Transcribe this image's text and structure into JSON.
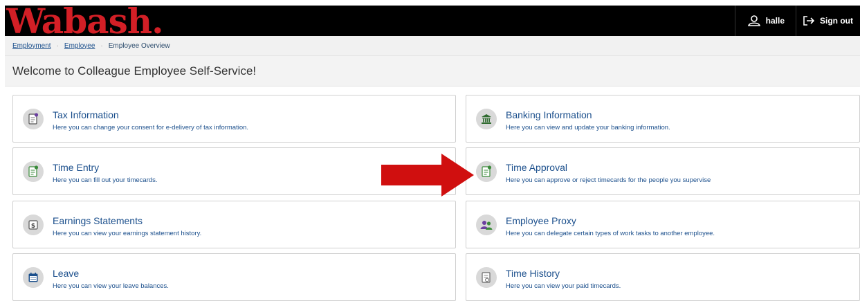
{
  "header": {
    "logo_text": "Wabash.",
    "user_label": "halle",
    "signout_label": "Sign out"
  },
  "breadcrumb": {
    "items": [
      "Employment",
      "Employee",
      "Employee Overview"
    ]
  },
  "welcome": "Welcome to Colleague Employee Self-Service!",
  "cards": [
    {
      "title": "Tax Information",
      "desc": "Here you can change your consent for e-delivery of tax information.",
      "icon": "tax-document-icon"
    },
    {
      "title": "Banking Information",
      "desc": "Here you can view and update your banking information.",
      "icon": "bank-icon"
    },
    {
      "title": "Time Entry",
      "desc": "Here you can fill out your timecards.",
      "icon": "timecard-icon"
    },
    {
      "title": "Time Approval",
      "desc": "Here you can approve or reject timecards for the people you supervise",
      "icon": "timecard-approve-icon"
    },
    {
      "title": "Earnings Statements",
      "desc": "Here you can view your earnings statement history.",
      "icon": "dollar-icon"
    },
    {
      "title": "Employee Proxy",
      "desc": "Here you can delegate certain types of work tasks to another employee.",
      "icon": "people-icon"
    },
    {
      "title": "Leave",
      "desc": "Here you can view your leave balances.",
      "icon": "calendar-icon"
    },
    {
      "title": "Time History",
      "desc": "Here you can view your paid timecards.",
      "icon": "history-icon"
    }
  ],
  "colors": {
    "accent_red": "#d31f26",
    "link_blue": "#1b4f8c",
    "icon_green": "#3a8a3a"
  }
}
